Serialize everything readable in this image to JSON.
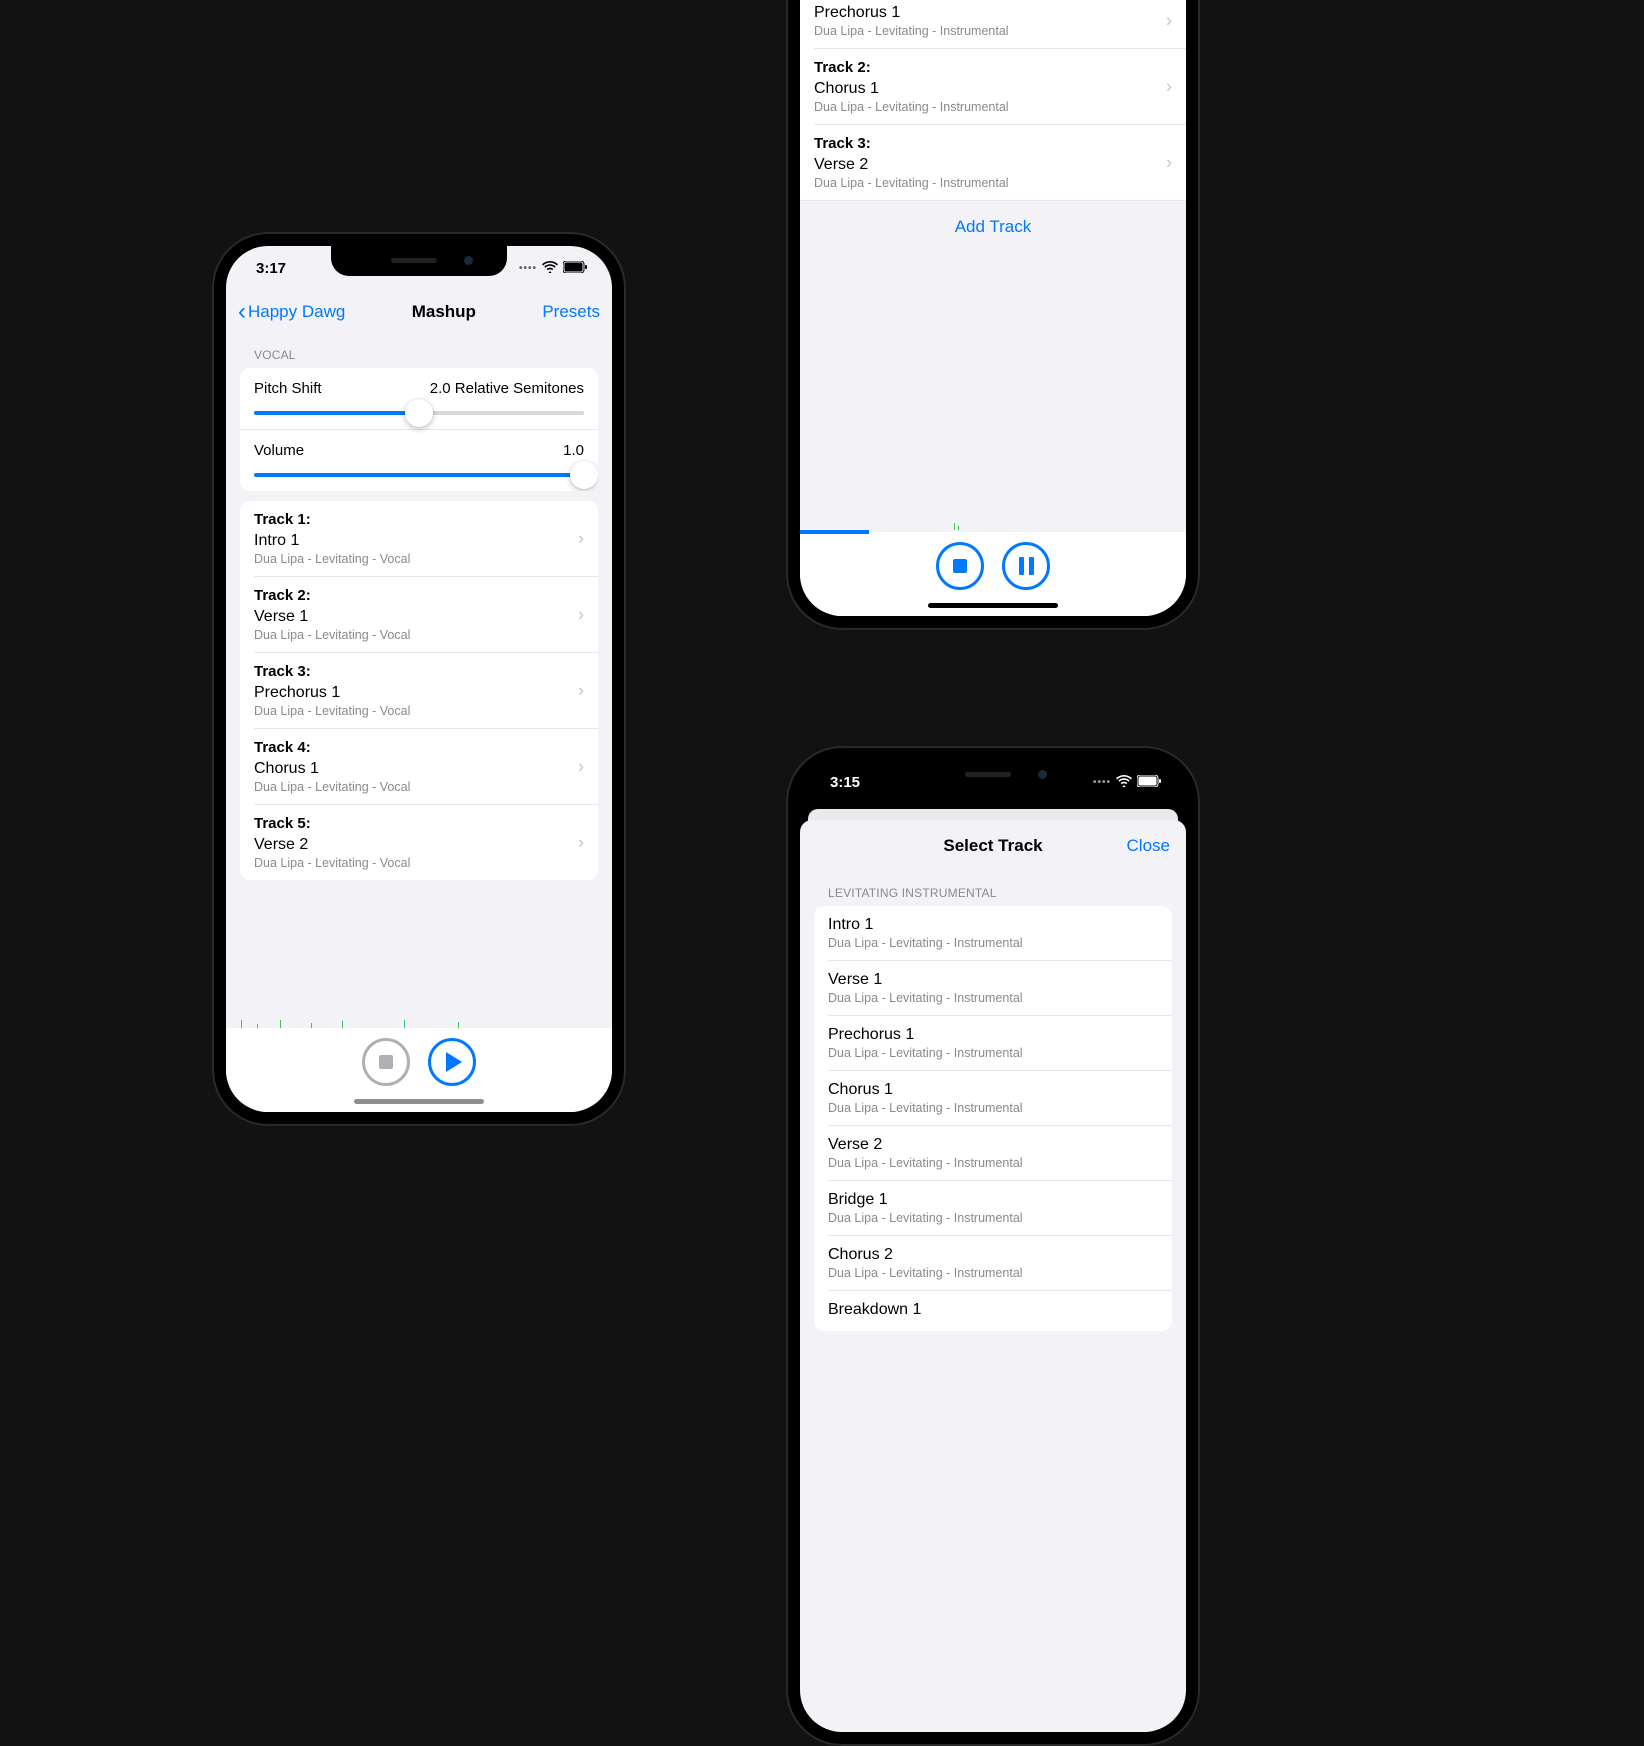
{
  "phone1": {
    "status_time": "3:17",
    "nav_back": "Happy Dawg",
    "nav_title": "Mashup",
    "nav_right": "Presets",
    "section": "VOCAL",
    "pitch_label": "Pitch Shift",
    "pitch_value": "2.0 Relative Semitones",
    "pitch_pct": 50,
    "volume_label": "Volume",
    "volume_value": "1.0",
    "volume_pct": 100,
    "tracks": [
      {
        "head": "Track 1:",
        "title": "Intro 1",
        "sub": "Dua Lipa - Levitating - Vocal"
      },
      {
        "head": "Track 2:",
        "title": "Verse 1",
        "sub": "Dua Lipa - Levitating - Vocal"
      },
      {
        "head": "Track 3:",
        "title": "Prechorus 1",
        "sub": "Dua Lipa - Levitating - Vocal"
      },
      {
        "head": "Track 4:",
        "title": "Chorus 1",
        "sub": "Dua Lipa - Levitating - Vocal"
      },
      {
        "head": "Track 5:",
        "title": "Verse 2",
        "sub": "Dua Lipa - Levitating - Vocal"
      }
    ]
  },
  "phone2": {
    "tracks": [
      {
        "head": "",
        "title": "Prechorus 1",
        "sub": "Dua Lipa - Levitating - Instrumental"
      },
      {
        "head": "Track 2:",
        "title": "Chorus 1",
        "sub": "Dua Lipa - Levitating - Instrumental"
      },
      {
        "head": "Track 3:",
        "title": "Verse 2",
        "sub": "Dua Lipa - Levitating - Instrumental"
      }
    ],
    "add_label": "Add Track",
    "progress_pct": 18
  },
  "phone3": {
    "status_time": "3:15",
    "sheet_title": "Select Track",
    "sheet_close": "Close",
    "section": "LEVITATING INSTRUMENTAL",
    "items": [
      {
        "title": "Intro 1",
        "sub": "Dua Lipa - Levitating - Instrumental"
      },
      {
        "title": "Verse 1",
        "sub": "Dua Lipa - Levitating - Instrumental"
      },
      {
        "title": "Prechorus 1",
        "sub": "Dua Lipa - Levitating - Instrumental"
      },
      {
        "title": "Chorus 1",
        "sub": "Dua Lipa - Levitating - Instrumental"
      },
      {
        "title": "Verse 2",
        "sub": "Dua Lipa - Levitating - Instrumental"
      },
      {
        "title": "Bridge 1",
        "sub": "Dua Lipa - Levitating - Instrumental"
      },
      {
        "title": "Chorus 2",
        "sub": "Dua Lipa - Levitating - Instrumental"
      },
      {
        "title": "Breakdown 1",
        "sub": ""
      }
    ]
  }
}
